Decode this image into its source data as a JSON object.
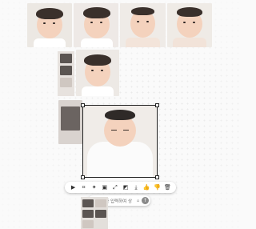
{
  "canvas": {
    "background": "#fafafa",
    "images": [
      {
        "name": "baby-photo-1"
      },
      {
        "name": "baby-photo-2"
      },
      {
        "name": "baby-photo-3"
      },
      {
        "name": "baby-photo-4"
      },
      {
        "name": "baby-photo-5"
      },
      {
        "name": "selected-sleeping-baby-photo"
      }
    ]
  },
  "toolbar": {
    "icons": [
      {
        "name": "select-cursor-icon",
        "glyph": "▶"
      },
      {
        "name": "crop-icon",
        "glyph": "⌗"
      },
      {
        "name": "magic-wand-icon",
        "glyph": "✦"
      },
      {
        "name": "edit-image-icon",
        "glyph": "▣"
      },
      {
        "name": "expand-icon",
        "glyph": "⤢"
      },
      {
        "name": "remove-background-icon",
        "glyph": "◩"
      },
      {
        "name": "download-icon",
        "glyph": "⤓"
      },
      {
        "name": "like-icon",
        "glyph": "👍"
      },
      {
        "name": "dislike-icon",
        "glyph": "👎"
      },
      {
        "name": "delete-icon",
        "glyph": "🗑"
      }
    ]
  },
  "prompt_bar": {
    "placeholder": "텍스트를 입력하여 상",
    "mini_icon": "⌂",
    "send_glyph": "↑"
  }
}
